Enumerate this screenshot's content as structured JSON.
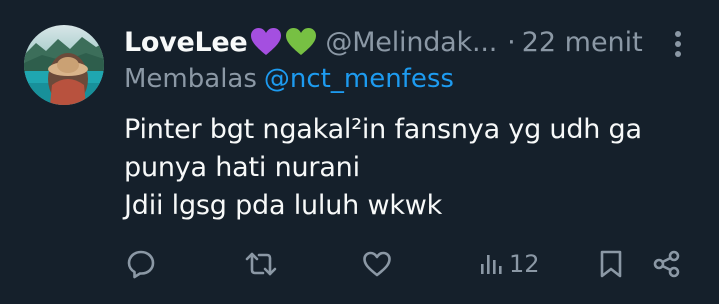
{
  "author": {
    "display_name": "LoveLee",
    "emoji_1": "purple-heart",
    "emoji_2": "green-heart",
    "handle": "@Melindak...",
    "separator": "·",
    "time": "22 menit"
  },
  "reply": {
    "prefix": "Membalas",
    "target": "@nct_menfess"
  },
  "body": {
    "line_1": "Pinter bgt ngakal²in fansnya yg udh ga",
    "line_2": "punya hati nurani",
    "line_3": "Jdii lgsg pda luluh wkwk"
  },
  "actions": {
    "views": "12"
  },
  "colors": {
    "background": "#15202b",
    "text_primary": "#f7f9f9",
    "text_secondary": "#8b98a5",
    "link": "#1d9bf0",
    "purple_heart": "#a44fe0",
    "green_heart": "#77c043"
  }
}
